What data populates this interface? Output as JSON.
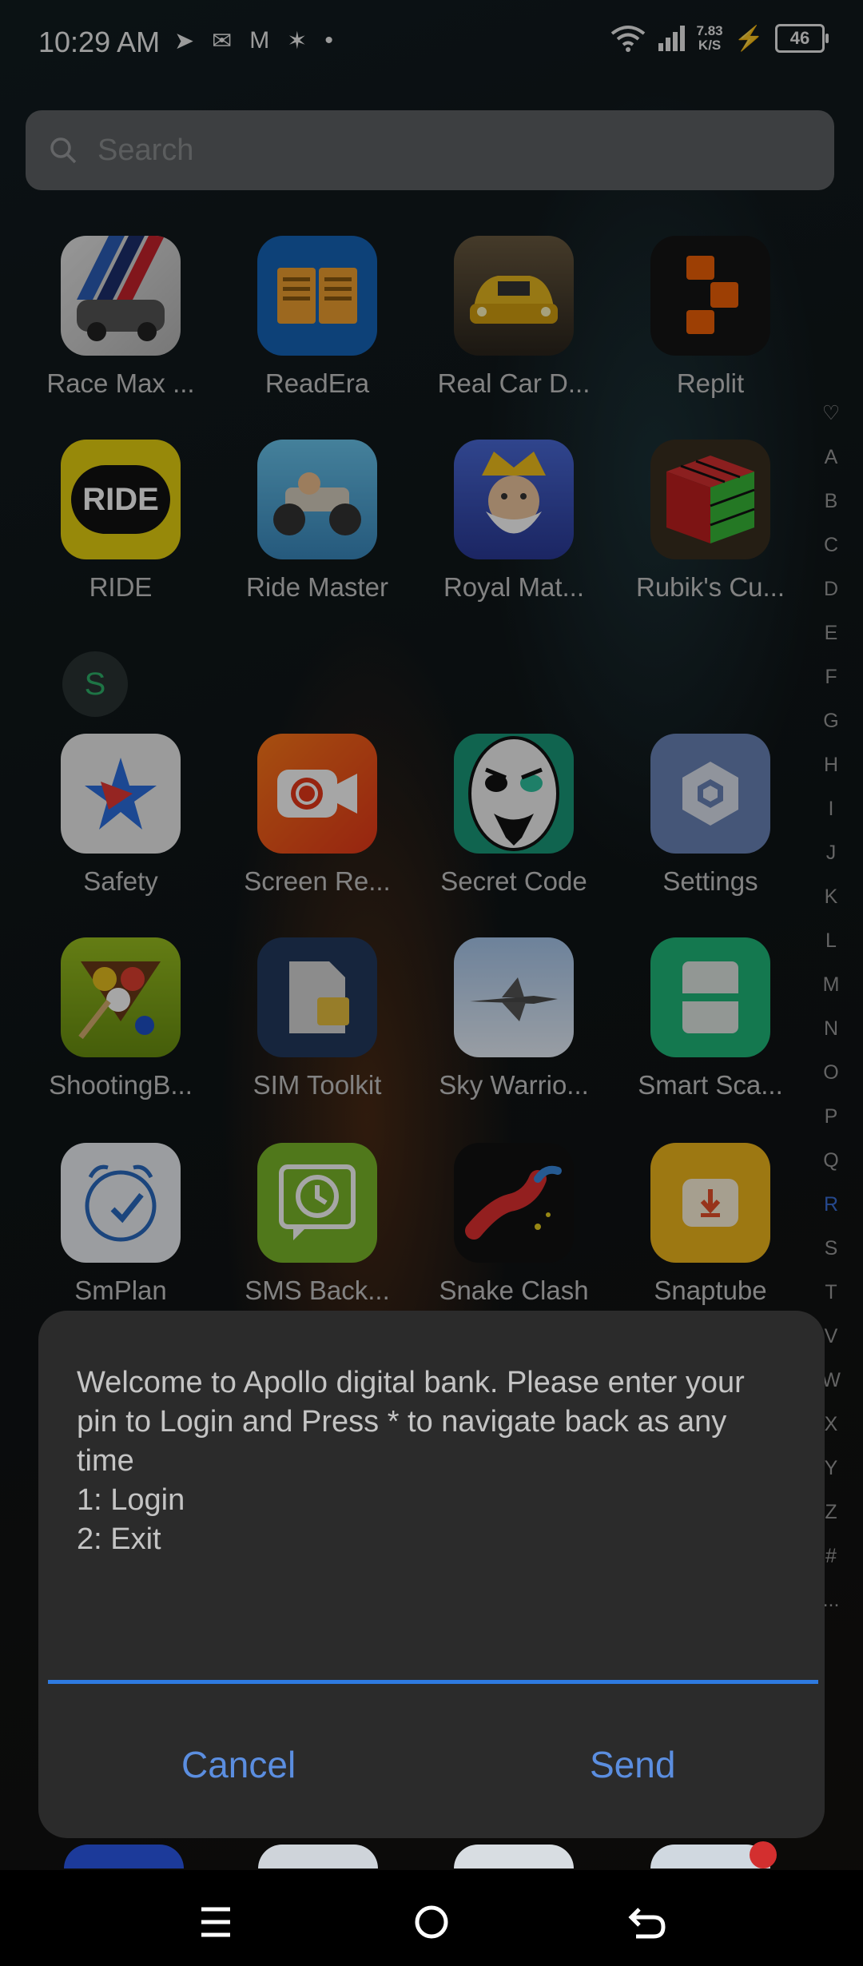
{
  "status_bar": {
    "time": "10:29 AM",
    "net_speed_value": "7.83",
    "net_speed_unit": "K/S",
    "battery": "46",
    "notification_icons": [
      "telegram-icon",
      "wechat-icon",
      "gmail-icon",
      "satellite-icon",
      "dot-icon"
    ]
  },
  "search": {
    "placeholder": "Search"
  },
  "apps": [
    {
      "label": "Race Max ...",
      "icon": "race-max-icon"
    },
    {
      "label": "ReadEra",
      "icon": "readera-icon"
    },
    {
      "label": "Real Car D...",
      "icon": "real-car-icon"
    },
    {
      "label": "Replit",
      "icon": "replit-icon"
    },
    {
      "label": "RIDE",
      "icon": "ride-icon"
    },
    {
      "label": "Ride Master",
      "icon": "ride-master-icon"
    },
    {
      "label": "Royal Mat...",
      "icon": "royal-match-icon"
    },
    {
      "label": "Rubik's Cu...",
      "icon": "rubiks-cube-icon"
    },
    {
      "label": "Safety",
      "icon": "safety-icon"
    },
    {
      "label": "Screen Re...",
      "icon": "screen-recorder-icon"
    },
    {
      "label": "Secret Code",
      "icon": "secret-code-icon"
    },
    {
      "label": "Settings",
      "icon": "settings-icon"
    },
    {
      "label": "ShootingB...",
      "icon": "shooting-ball-icon"
    },
    {
      "label": "SIM Toolkit",
      "icon": "sim-toolkit-icon"
    },
    {
      "label": "Sky Warrio...",
      "icon": "sky-warrior-icon"
    },
    {
      "label": "Smart Sca...",
      "icon": "smart-scanner-icon"
    },
    {
      "label": "SmPlan",
      "icon": "smplan-icon"
    },
    {
      "label": "SMS Back...",
      "icon": "sms-backup-icon"
    },
    {
      "label": "Snake Clash",
      "icon": "snake-clash-icon"
    },
    {
      "label": "Snaptube",
      "icon": "snaptube-icon"
    }
  ],
  "ride_icon_text": "RIDE",
  "section_letter": "S",
  "alphabet_index": [
    "♡",
    "A",
    "B",
    "C",
    "D",
    "E",
    "F",
    "G",
    "H",
    "I",
    "J",
    "K",
    "L",
    "M",
    "N",
    "O",
    "P",
    "Q",
    "R",
    "S",
    "T",
    "V",
    "W",
    "X",
    "Y",
    "Z",
    "#",
    "..."
  ],
  "alphabet_active": "R",
  "dialog": {
    "message": "Welcome to Apollo digital bank. Please enter your pin to Login and Press * to navigate back as any time\n1: Login\n2: Exit",
    "input_value": "",
    "cancel_label": "Cancel",
    "send_label": "Send"
  },
  "nav_bar": {
    "buttons": [
      "menu-icon",
      "home-icon",
      "back-icon"
    ]
  },
  "colors": {
    "accent": "#2e7ae0",
    "button_text": "#5b8ee0",
    "dialog_bg": "#2b2b2b"
  }
}
